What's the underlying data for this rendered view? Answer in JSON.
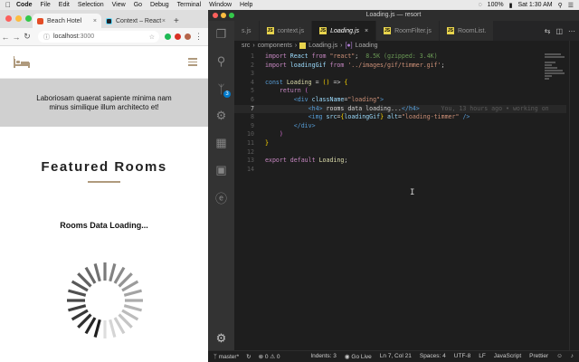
{
  "menubar": {
    "apple": "",
    "items": [
      "Code",
      "File",
      "Edit",
      "Selection",
      "View",
      "Go",
      "Debug",
      "Terminal",
      "Window",
      "Help"
    ],
    "battery": "100%",
    "clock": "Sat 1:30 AM"
  },
  "browser": {
    "tabs": [
      {
        "label": "Beach Hotel",
        "active": true,
        "favicon_color": "#e44d26"
      },
      {
        "label": "Context – React",
        "active": false,
        "favicon_color": "#20232a"
      }
    ],
    "new_tab": "+",
    "address": {
      "host": "localhost",
      "port": ":3000"
    },
    "page": {
      "hero_line1": "Laboriosam quaerat sapiente minima nam",
      "hero_line2": "minus similique illum architecto et!",
      "featured_title": "Featured Rooms",
      "loading_text": "Rooms Data Loading..."
    }
  },
  "vscode": {
    "title": "Loading.js — resort",
    "tabs": [
      {
        "label": "s.js",
        "active": false,
        "icon": false
      },
      {
        "label": "context.js",
        "active": false,
        "icon": true
      },
      {
        "label": "Loading.js",
        "active": true,
        "icon": true
      },
      {
        "label": "RoomFilter.js",
        "active": false,
        "icon": true
      },
      {
        "label": "RoomList.",
        "active": false,
        "icon": true
      }
    ],
    "breadcrumb": {
      "src": "src",
      "components": "components",
      "file": "Loading.js",
      "symbol": "Loading"
    },
    "activity_badge": "3",
    "code_lines": [
      {
        "n": "1",
        "html_parts": [
          [
            "kw",
            "import "
          ],
          [
            "var",
            "React"
          ],
          [
            "kw",
            " from "
          ],
          [
            "str",
            "\"react\""
          ],
          [
            "txt",
            ";  "
          ],
          [
            "cmt",
            "8.5K (gzipped: 3.4K)"
          ]
        ]
      },
      {
        "n": "2",
        "html_parts": [
          [
            "kw",
            "import "
          ],
          [
            "var",
            "loadingGif"
          ],
          [
            "kw",
            " from "
          ],
          [
            "str",
            "'../images/gif/timmer.gif'"
          ],
          [
            "txt",
            ";"
          ]
        ]
      },
      {
        "n": "3",
        "html_parts": []
      },
      {
        "n": "4",
        "html_parts": [
          [
            "kwb",
            "const "
          ],
          [
            "fn",
            "Loading"
          ],
          [
            "txt",
            " = "
          ],
          [
            "br2",
            "()"
          ],
          [
            "txt",
            " => "
          ],
          [
            "br2",
            "{"
          ]
        ]
      },
      {
        "n": "5",
        "html_parts": [
          [
            "txt",
            "    "
          ],
          [
            "kw",
            "return "
          ],
          [
            "br",
            "("
          ]
        ]
      },
      {
        "n": "6",
        "html_parts": [
          [
            "txt",
            "        "
          ],
          [
            "tag",
            "<div "
          ],
          [
            "attr",
            "className"
          ],
          [
            "txt",
            "="
          ],
          [
            "str",
            "\"loading\""
          ],
          [
            "tag",
            ">"
          ]
        ]
      },
      {
        "n": "7",
        "html_parts": [
          [
            "txt",
            "            "
          ],
          [
            "tag",
            "<h4>"
          ],
          [
            "txt",
            " rooms data loading..."
          ],
          [
            "tag",
            "</h4>"
          ],
          [
            "blame",
            "      You, 13 hours ago • working on"
          ]
        ]
      },
      {
        "n": "8",
        "html_parts": [
          [
            "txt",
            "            "
          ],
          [
            "tag",
            "<img "
          ],
          [
            "attr",
            "src"
          ],
          [
            "txt",
            "="
          ],
          [
            "br2",
            "{"
          ],
          [
            "var",
            "loadingGif"
          ],
          [
            "br2",
            "}"
          ],
          [
            "attr",
            " alt"
          ],
          [
            "txt",
            "="
          ],
          [
            "str",
            "\"loading-timmer\""
          ],
          [
            "tag",
            " />"
          ]
        ]
      },
      {
        "n": "9",
        "html_parts": [
          [
            "txt",
            "        "
          ],
          [
            "tag",
            "</div>"
          ]
        ]
      },
      {
        "n": "10",
        "html_parts": [
          [
            "txt",
            "    "
          ],
          [
            "br",
            ")"
          ]
        ]
      },
      {
        "n": "11",
        "html_parts": [
          [
            "br2",
            "}"
          ]
        ]
      },
      {
        "n": "12",
        "html_parts": []
      },
      {
        "n": "13",
        "html_parts": [
          [
            "kw",
            "export "
          ],
          [
            "kw",
            "default "
          ],
          [
            "fn",
            "Loading"
          ],
          [
            "txt",
            ";"
          ]
        ]
      },
      {
        "n": "14",
        "html_parts": []
      }
    ],
    "current_line": "7",
    "statusbar": {
      "branch": "master*",
      "errors": "0",
      "warnings": "0",
      "indents": "Indents: 3",
      "golive": "Go Live",
      "position": "Ln 7, Col 21",
      "spaces": "Spaces: 4",
      "encoding": "UTF-8",
      "eol": "LF",
      "language": "JavaScript",
      "formatter": "Prettier"
    }
  },
  "colors": {
    "accent_gold": "#af9a7d",
    "vscode_blue": "#007acc",
    "js_yellow": "#e8d44d"
  }
}
